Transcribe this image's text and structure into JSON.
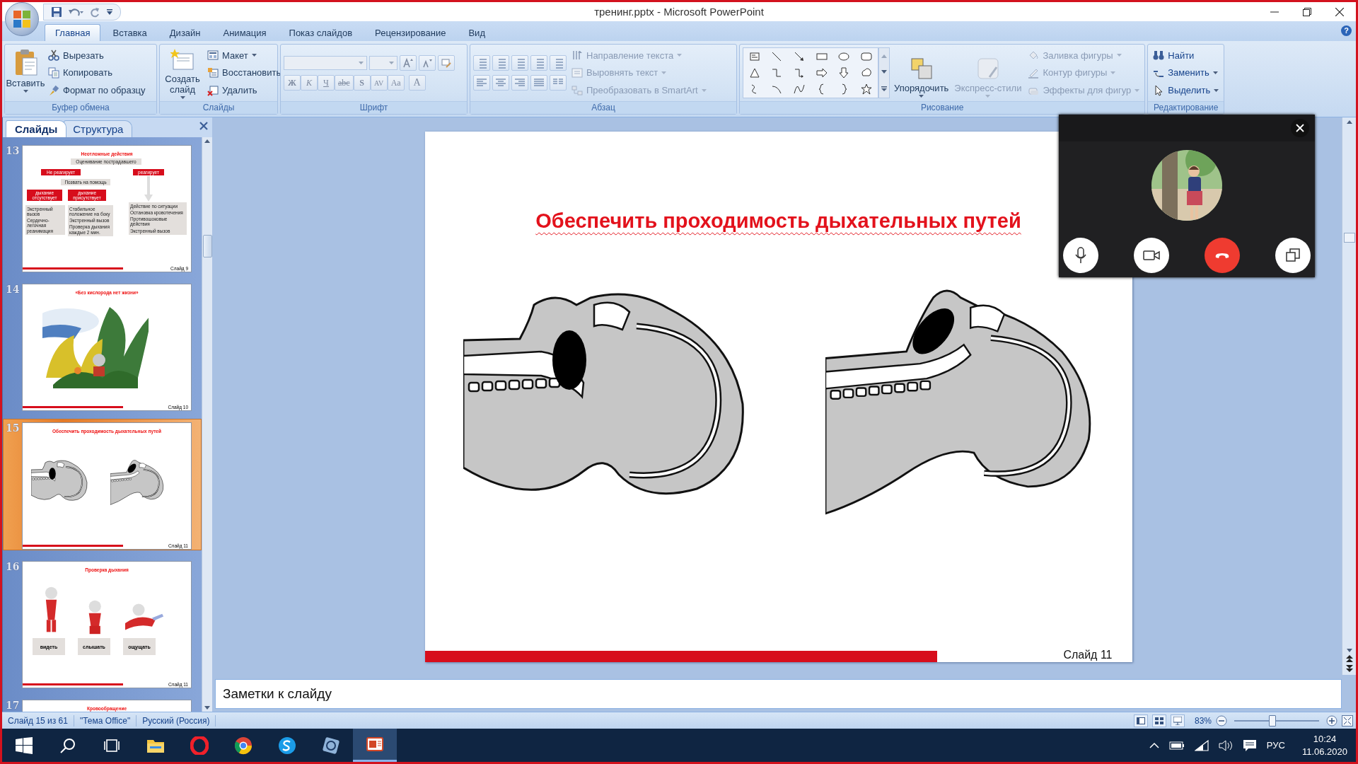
{
  "window": {
    "title": "тренинг.pptx - Microsoft PowerPoint"
  },
  "ribbon_tabs": [
    {
      "label": "Главная",
      "selected": true
    },
    {
      "label": "Вставка",
      "selected": false
    },
    {
      "label": "Дизайн",
      "selected": false
    },
    {
      "label": "Анимация",
      "selected": false
    },
    {
      "label": "Показ слайдов",
      "selected": false
    },
    {
      "label": "Рецензирование",
      "selected": false
    },
    {
      "label": "Вид",
      "selected": false
    }
  ],
  "help": "?",
  "clipboard": {
    "label": "Буфер обмена",
    "paste": "Вставить",
    "commands": [
      "Вырезать",
      "Копировать",
      "Формат по образцу"
    ]
  },
  "slides_group": {
    "label": "Слайды",
    "new_slide": "Создать слайд",
    "commands": [
      {
        "label": "Макет",
        "dropdown": true
      },
      {
        "label": "Восстановить",
        "dropdown": false
      },
      {
        "label": "Удалить",
        "dropdown": false
      }
    ]
  },
  "font": {
    "label": "Шрифт",
    "buttons": [
      "Ж",
      "К",
      "Ч",
      "abc",
      "S",
      "AV",
      "Aa",
      "A"
    ]
  },
  "paragraph": {
    "label": "Абзац",
    "commands": [
      {
        "label": "Направление текста",
        "disabled": true
      },
      {
        "label": "Выровнять текст",
        "disabled": true
      },
      {
        "label": "Преобразовать в SmartArt",
        "disabled": true
      }
    ]
  },
  "drawing": {
    "label": "Рисование",
    "big_buttons": [
      {
        "label": "Упорядочить",
        "disabled": false
      },
      {
        "label": "Экспресс-стили",
        "disabled": true
      }
    ],
    "commands": [
      {
        "label": "Заливка фигуры",
        "disabled": true
      },
      {
        "label": "Контур фигуры",
        "disabled": true
      },
      {
        "label": "Эффекты для фигур",
        "disabled": true
      }
    ]
  },
  "editing": {
    "label": "Редактирование",
    "commands": [
      {
        "label": "Найти",
        "dropdown": false
      },
      {
        "label": "Заменить",
        "dropdown": true
      },
      {
        "label": "Выделить",
        "dropdown": true
      }
    ]
  },
  "panel": {
    "tabs": [
      {
        "label": "Слайды",
        "selected": true
      },
      {
        "label": "Структура",
        "selected": false
      }
    ],
    "thumbnails": [
      {
        "number": "13",
        "selected": false,
        "kind": "flowchart",
        "title": "Неотложные действия",
        "footer": "Слайд 9",
        "nodes": [
          "Оценивание пострадавшего",
          "Не реагирует",
          "реагирует",
          "Позвать на помощь",
          "дыхание отсутствует",
          "дыхание присутствует"
        ],
        "notes": [
          [
            "Экстренный вызов",
            "Сердечно-легочная реанимация"
          ],
          [
            "Стабильное положение на боку",
            "Экстренный вызов",
            "Проверка дыхания каждые 2 мин."
          ],
          [
            "Действие по ситуации",
            "Остановка кровотечения",
            "Противошоковые действия",
            "Экстренный вызов"
          ]
        ]
      },
      {
        "number": "14",
        "selected": false,
        "kind": "illustration",
        "title": "«Без кислорода нет жизни»",
        "footer": "Слайд 10"
      },
      {
        "number": "15",
        "selected": true,
        "kind": "airway",
        "title": "Обеспечить проходимость дыхательных путей",
        "footer": "Слайд 11"
      },
      {
        "number": "16",
        "selected": false,
        "kind": "figures",
        "title": "Проверка дыхания",
        "footer": "Слайд 11",
        "labels": [
          "видеть",
          "слышать",
          "ощущать"
        ]
      },
      {
        "number": "17",
        "selected": false,
        "kind": "title",
        "title": "Кровообращение"
      }
    ]
  },
  "slide": {
    "title": "Обеспечить проходимость дыхательных путей",
    "footer": "Слайд 11"
  },
  "notes": {
    "text": "Заметки к слайду"
  },
  "status_bar": {
    "items": [
      "Слайд 15 из 61",
      "\"Тема Office\"",
      "Русский (Россия)"
    ],
    "zoom": {
      "reading": "83%",
      "level": 0.45
    }
  },
  "taskbar": {
    "apps": [
      {
        "kind": "explorer",
        "selected": false
      },
      {
        "kind": "opera",
        "selected": false
      },
      {
        "kind": "chrome",
        "selected": false
      },
      {
        "kind": "skype",
        "selected": false
      },
      {
        "kind": "viewer",
        "selected": false
      },
      {
        "kind": "powerpoint",
        "selected": true
      }
    ],
    "language": "РУС",
    "time": "10:24",
    "date": "11.06.2020"
  }
}
